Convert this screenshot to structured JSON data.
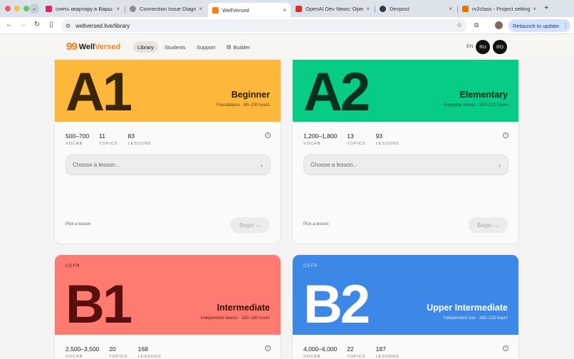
{
  "browser": {
    "tabs": [
      {
        "label": "снять квартиру в Варш",
        "favicon_color": "#e0245e",
        "active": false
      },
      {
        "label": "Connection Issue Diagno",
        "favicon_color": "#8a8f96",
        "active": false
      },
      {
        "label": "WellVersed",
        "favicon_color": "#f07f1a",
        "active": true
      },
      {
        "label": "OpenAI Dev News: Open",
        "favicon_color": "#d93025",
        "active": false
      },
      {
        "label": "Devpost",
        "favicon_color": "#2a3a4a",
        "active": false
      },
      {
        "label": "rv2class - Project setting",
        "favicon_color": "#e37400",
        "active": false
      }
    ],
    "tab_close": "×",
    "new_tab": "+",
    "url": "wellversed.live/library",
    "relaunch_label": "Relaunch to update",
    "nav_icons": {
      "back": "←",
      "forward": "→",
      "reload": "↻",
      "sidebar": "▯",
      "star": "☆",
      "extensions": "⧉",
      "menu": "⋮",
      "tune": "⚙"
    }
  },
  "app": {
    "logo_mark": "99",
    "logo_well": "Well",
    "logo_versed": "Versed",
    "nav": {
      "library": "Library",
      "students": "Students",
      "support": "Support",
      "builder": "Builder",
      "builder_icon": "▤"
    },
    "lang": "EN",
    "avatars": [
      "RU",
      "RO"
    ]
  },
  "cards": [
    {
      "level": "A1",
      "name": "Beginner",
      "subtitle": "Foundations · 80–100 hours",
      "colors": {
        "banner": "#fdb73b",
        "big": "#3a2606",
        "text": "#2a1d05"
      },
      "stats": [
        {
          "num": "500–700",
          "label": "VOCAB"
        },
        {
          "num": "11",
          "label": "TOPICS"
        },
        {
          "num": "83",
          "label": "LESSONS"
        }
      ],
      "select_placeholder": "Choose a lesson...",
      "pick_label": "Pick a lesson",
      "begin_label": "Begin →"
    },
    {
      "level": "A2",
      "name": "Elementary",
      "subtitle": "Everyday stories · 100–120 hours",
      "colors": {
        "banner": "#06cc86",
        "big": "#08301f",
        "text": "#082a1c"
      },
      "stats": [
        {
          "num": "1,200–1,800",
          "label": "VOCAB"
        },
        {
          "num": "13",
          "label": "TOPICS"
        },
        {
          "num": "93",
          "label": "LESSONS"
        }
      ],
      "select_placeholder": "Choose a lesson...",
      "pick_label": "Pick a lesson",
      "begin_label": "Begin →"
    },
    {
      "cefr": "CEFR",
      "level": "B1",
      "name": "Intermediate",
      "subtitle": "Independent basics · 150–180 hours",
      "colors": {
        "banner": "#fd7b70",
        "big": "#5a0f0c",
        "text": "#3d0b09"
      },
      "stats": [
        {
          "num": "2,500–3,500",
          "label": "VOCAB"
        },
        {
          "num": "20",
          "label": "TOPICS"
        },
        {
          "num": "168",
          "label": "LESSONS"
        }
      ]
    },
    {
      "cefr": "CEFR",
      "level": "B2",
      "name": "Upper Intermediate",
      "subtitle": "Independent use · 180–220 hours",
      "colors": {
        "banner": "#3d88e6",
        "big": "#ffffff",
        "text": "#ffffff"
      },
      "stats": [
        {
          "num": "4,000–6,000",
          "label": "VOCAB"
        },
        {
          "num": "22",
          "label": "TOPICS"
        },
        {
          "num": "187",
          "label": "LESSONS"
        }
      ]
    }
  ],
  "info_glyph": "i",
  "chevron_glyph": "›"
}
